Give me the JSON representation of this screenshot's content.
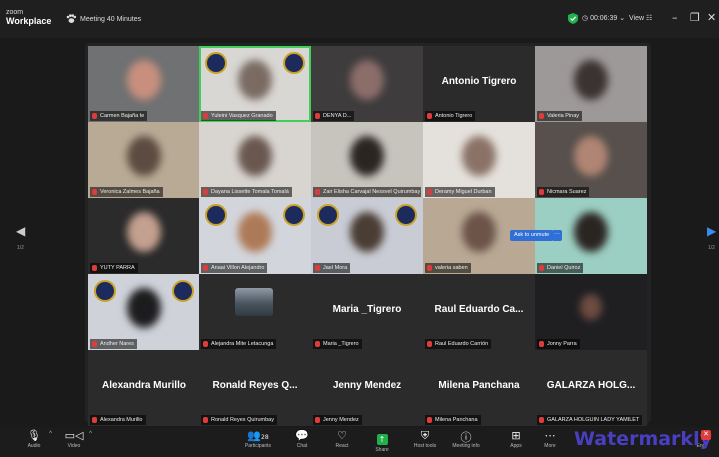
{
  "titlebar": {
    "brand_top": "zoom",
    "brand_bottom": "Workplace",
    "meeting_title": "Meeting 40 Minutes",
    "timer": "00:06:39",
    "view_label": "View",
    "minimize": "–",
    "restore": "❐",
    "close": "✕"
  },
  "tiles": [
    {
      "name": "Carmen Bajaña te",
      "kind": "video",
      "bg": "#6f7172",
      "face": "#c98f7e"
    },
    {
      "name": "Yuleini Vasquez Granado",
      "kind": "video",
      "bg": "#d9d7d3",
      "face": "#7a6b62",
      "speaker": true
    },
    {
      "name": "DENYA D...",
      "kind": "video",
      "bg": "#3f3c3e",
      "face": "#8b6e6a"
    },
    {
      "name": "Antonio Tigrero",
      "kind": "name",
      "big": "Antonio Tigrero"
    },
    {
      "name": "Valeria Pinay",
      "kind": "video",
      "bg": "#9d9998",
      "face": "#3a3332"
    },
    {
      "name": "Veronica Zalmes Bajaña",
      "kind": "video",
      "bg": "#b9aa95",
      "face": "#5c4b40"
    },
    {
      "name": "Dayana Lissette Tomala Tomalá",
      "kind": "video",
      "bg": "#d8d4cf",
      "face": "#6a5750"
    },
    {
      "name": "Zair Elisha Carvajal Nessvel Quirumbay",
      "kind": "video",
      "bg": "#c7c3bd",
      "face": "#2a2522"
    },
    {
      "name": "Deramy Miguel Durban",
      "kind": "video",
      "bg": "#e4e0db",
      "face": "#8a7266"
    },
    {
      "name": "Nicmara Suarez",
      "kind": "video",
      "bg": "#57504c",
      "face": "#b08573"
    },
    {
      "name": "YUTY PARRA",
      "kind": "video",
      "bg": "#2b2b2b",
      "face": "#c3a08f"
    },
    {
      "name": "Anaai Villon Alejandro",
      "kind": "video",
      "bg": "#d3d5dc",
      "face": "#ad7a57"
    },
    {
      "name": "Jael Mora",
      "kind": "video",
      "bg": "#c9ccd5",
      "face": "#4a3d33"
    },
    {
      "name": "valeria saben",
      "kind": "video",
      "bg": "#b8a894",
      "face": "#6c5449"
    },
    {
      "name": "Daniel Quiroz",
      "kind": "video",
      "bg": "#9ccfc3",
      "face": "#2b2522"
    },
    {
      "name": "Andher Nares",
      "kind": "video",
      "bg": "#cfd2d9",
      "face": "#1c1c1e"
    },
    {
      "name": "Alejandra Mite Letacunga",
      "kind": "cam"
    },
    {
      "name": "Maria _Tigrero",
      "kind": "name",
      "big": "Maria _Tigrero"
    },
    {
      "name": "Raul Eduardo Carrión",
      "kind": "name",
      "big": "Raul Eduardo Ca..."
    },
    {
      "name": "Jonny Parra",
      "kind": "video",
      "bg": "#1f1f22",
      "face": "#6e4c41",
      "small": true
    },
    {
      "name": "Alexandra Murillo",
      "kind": "name",
      "big": "Alexandra Murillo"
    },
    {
      "name": "Ronald Reyes Quirumbay",
      "kind": "name",
      "big": "Ronald Reyes Q..."
    },
    {
      "name": "Jenny Mendez",
      "kind": "name",
      "big": "Jenny Mendez"
    },
    {
      "name": "Milena Panchana",
      "kind": "name",
      "big": "Milena Panchana"
    },
    {
      "name": "GALARZA HOLGUIN LADY YAMILET",
      "kind": "name",
      "big": "GALARZA HOLG..."
    }
  ],
  "ask_unmute": "Ask to unmute",
  "ask_more": "···",
  "paging": {
    "left": "1/2",
    "right": "1/2"
  },
  "toolbar": {
    "audio": {
      "label": "Audio",
      "icon": "microphone-icon"
    },
    "video": {
      "label": "Video",
      "icon": "video-camera-icon"
    },
    "participants": {
      "label": "Participants",
      "count": "28"
    },
    "chat": {
      "label": "Chat"
    },
    "react": {
      "label": "React"
    },
    "share": {
      "label": "Share"
    },
    "host_tools": {
      "label": "Host tools"
    },
    "meeting_info": {
      "label": "Meeting info"
    },
    "apps": {
      "label": "Apps"
    },
    "more": {
      "label": "More"
    },
    "end": {
      "label": "End"
    }
  },
  "watermark": "Watermarkly"
}
